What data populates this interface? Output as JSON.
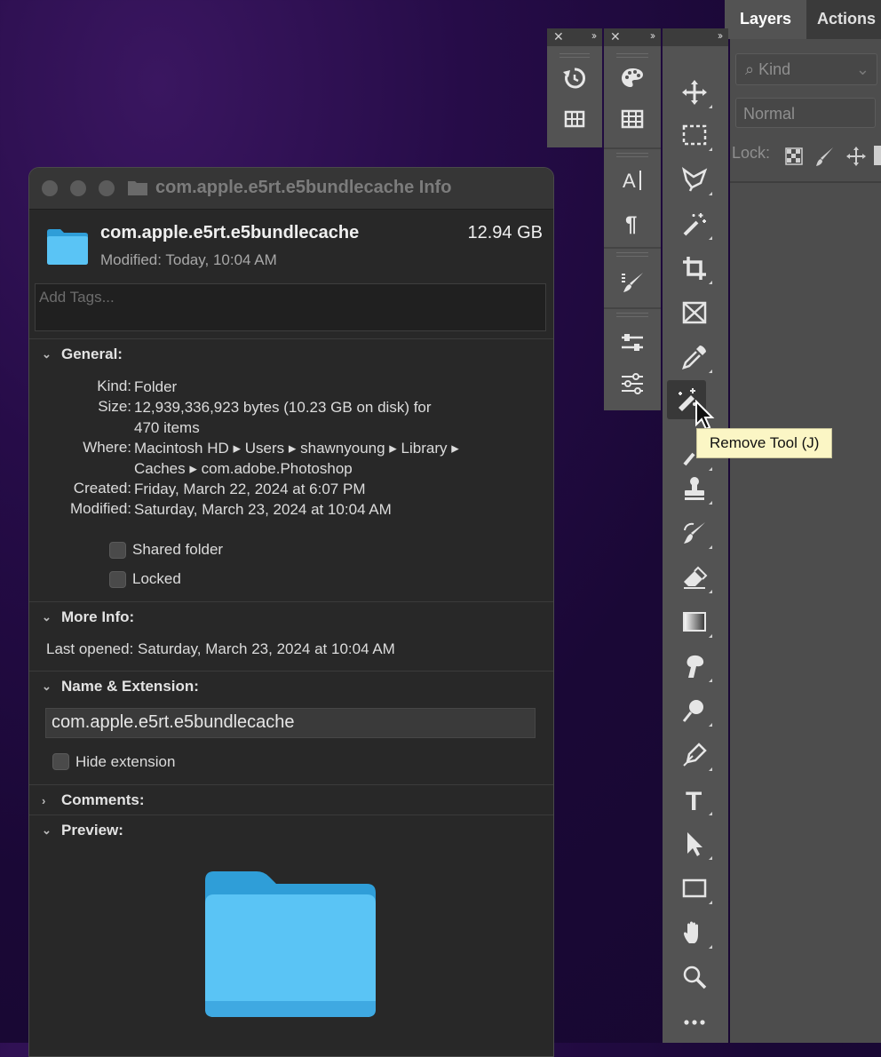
{
  "layers_panel": {
    "tabs": [
      "Layers",
      "Actions"
    ],
    "kind_filter": "Kind",
    "blend_mode": "Normal",
    "lock_label": "Lock:"
  },
  "tooltip": {
    "text": "Remove Tool (J)"
  },
  "info_window": {
    "title": "com.apple.e5rt.e5bundlecache Info",
    "header": {
      "name": "com.apple.e5rt.e5bundlecache",
      "size": "12.94 GB",
      "modified": "Modified: Today, 10:04 AM"
    },
    "tags_placeholder": "Add Tags...",
    "general": {
      "heading": "General:",
      "kind_label": "Kind:",
      "kind": "Folder",
      "size_label": "Size:",
      "size_line1": "12,939,336,923 bytes (10.23 GB on disk) for",
      "size_line2": "470 items",
      "where_label": "Where:",
      "where_line1": "Macintosh HD ▸ Users ▸ shawnyoung ▸ Library ▸",
      "where_line2": "Caches ▸ com.adobe.Photoshop",
      "created_label": "Created:",
      "created": "Friday, March 22, 2024 at 6:07 PM",
      "modified_label": "Modified:",
      "modified": "Saturday, March 23, 2024 at 10:04 AM",
      "shared_folder": "Shared folder",
      "locked": "Locked"
    },
    "more_info": {
      "heading": "More Info:",
      "last_opened": "Last opened: Saturday, March 23, 2024 at 10:04 AM"
    },
    "name_extension": {
      "heading": "Name & Extension:",
      "value": "com.apple.e5rt.e5bundlecache",
      "hide_extension": "Hide extension"
    },
    "comments_heading": "Comments:",
    "preview_heading": "Preview:"
  },
  "colors": {
    "folder_blue": "#5ac4f5",
    "panel_gray": "#535353",
    "window_bg": "#282828",
    "tooltip_bg": "#fbf6c5"
  }
}
